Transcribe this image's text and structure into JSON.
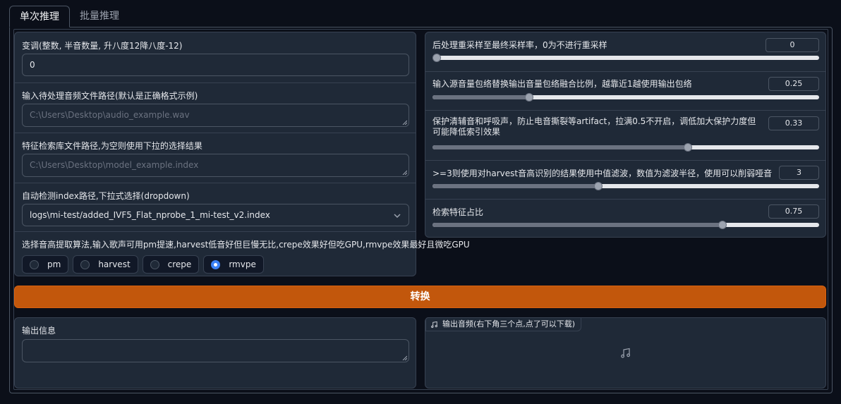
{
  "tabs": [
    {
      "label": "单次推理",
      "active": true
    },
    {
      "label": "批量推理",
      "active": false
    }
  ],
  "left": {
    "transpose": {
      "label": "变调(整数, 半音数量, 升八度12降八度-12)",
      "value": "0"
    },
    "input_path": {
      "label": "输入待处理音频文件路径(默认是正确格式示例)",
      "placeholder": "C:\\Users\\Desktop\\audio_example.wav"
    },
    "index_path": {
      "label": "特征检索库文件路径,为空则使用下拉的选择结果",
      "placeholder": "C:\\Users\\Desktop\\model_example.index"
    },
    "index_dropdown": {
      "label": "自动检测index路径,下拉式选择(dropdown)",
      "value": "logs\\mi-test/added_IVF5_Flat_nprobe_1_mi-test_v2.index"
    },
    "f0_method": {
      "label": "选择音高提取算法,输入歌声可用pm提速,harvest低音好但巨慢无比,crepe效果好但吃GPU,rmvpe效果最好且微吃GPU",
      "options": [
        "pm",
        "harvest",
        "crepe",
        "rmvpe"
      ],
      "selected": "rmvpe"
    }
  },
  "right": {
    "sliders": [
      {
        "label": "后处理重采样至最终采样率，0为不进行重采样",
        "value": "0",
        "fraction": 0.0
      },
      {
        "label": "输入源音量包络替换输出音量包络融合比例，越靠近1越使用输出包络",
        "value": "0.25",
        "fraction": 0.25
      },
      {
        "label": "保护清辅音和呼吸声，防止电音撕裂等artifact，拉满0.5不开启，调低加大保护力度但可能降低索引效果",
        "value": "0.33",
        "fraction": 0.66
      },
      {
        "label": ">=3则使用对harvest音高识别的结果使用中值滤波，数值为滤波半径，使用可以削弱哑音",
        "value": "3",
        "fraction": 0.4286
      },
      {
        "label": "检索特征占比",
        "value": "0.75",
        "fraction": 0.75
      }
    ]
  },
  "convert_button": "转换",
  "output_info": {
    "label": "输出信息"
  },
  "output_audio": {
    "label": "输出音频(右下角三个点,点了可以下载)"
  },
  "colors": {
    "accent": "#c2570c",
    "radio_selected": "#3b82f6"
  }
}
